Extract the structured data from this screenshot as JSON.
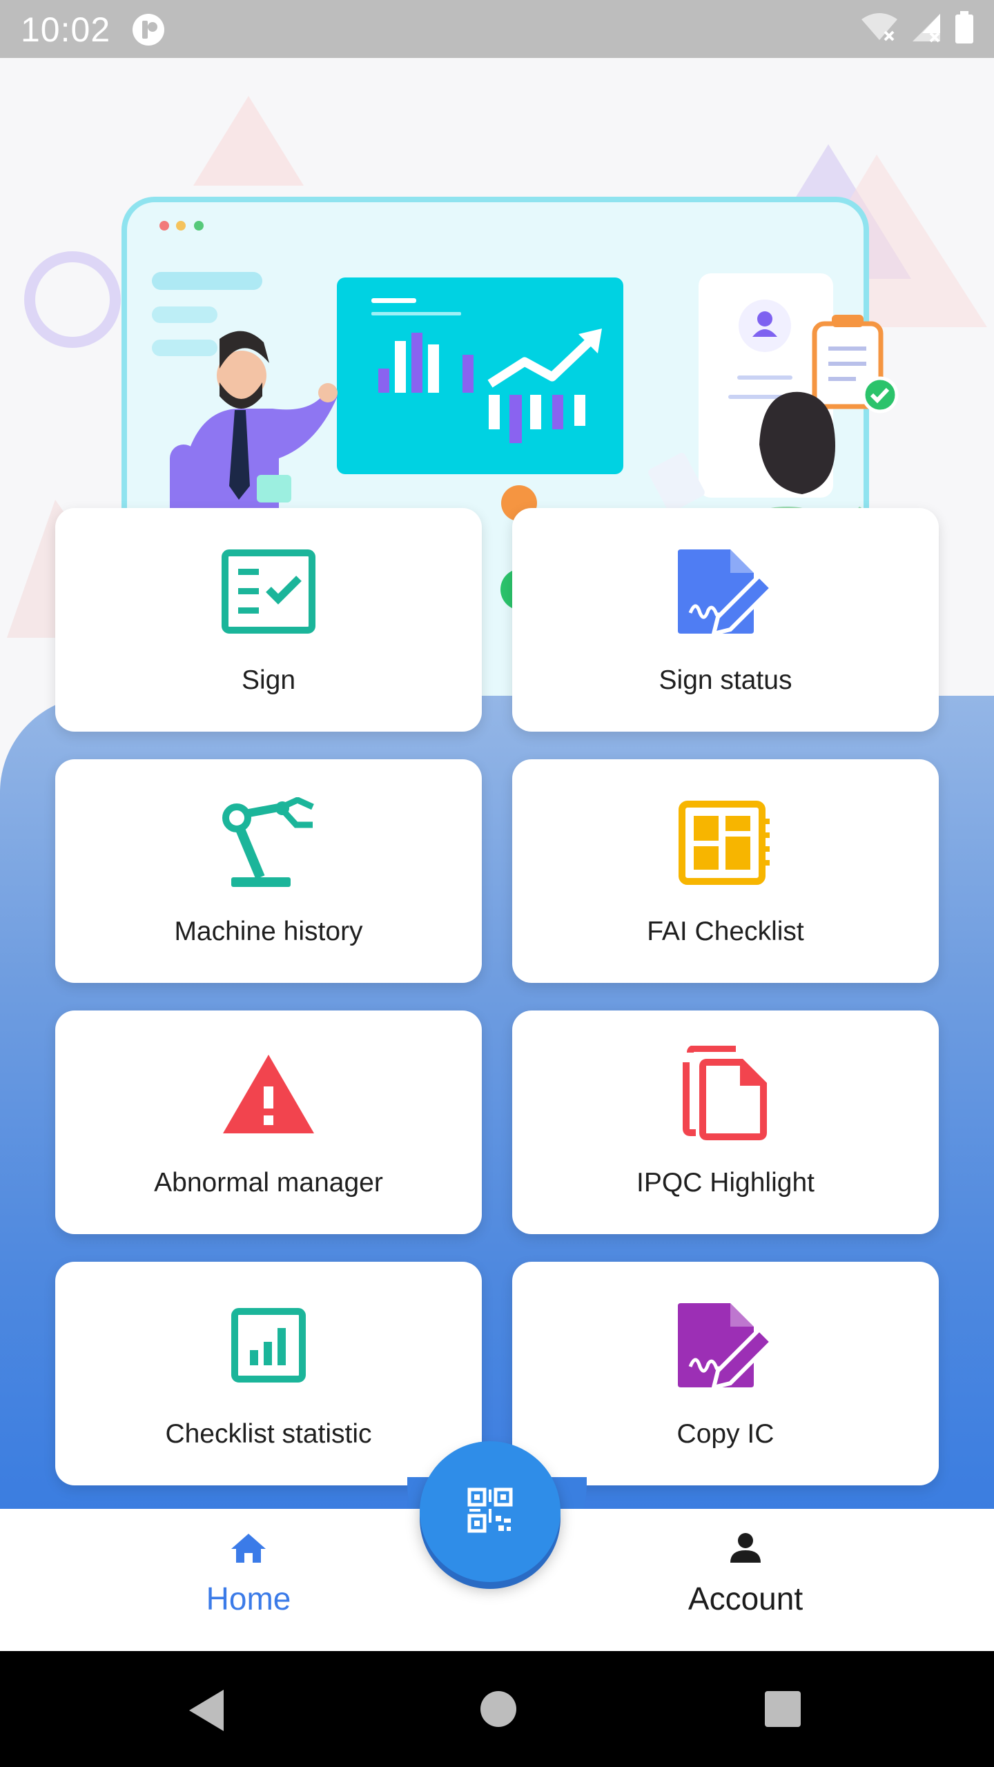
{
  "status_bar": {
    "time": "10:02"
  },
  "colors": {
    "teal": "#1bb59a",
    "blue": "#4f7df3",
    "amber": "#f7b500",
    "red": "#f2444e",
    "purple": "#9c2fb5",
    "nav_active": "#3b7be8",
    "fab": "#2f8de8"
  },
  "menu": {
    "items": [
      {
        "label": "Sign",
        "icon": "checklist-form-icon"
      },
      {
        "label": "Sign status",
        "icon": "document-signature-icon"
      },
      {
        "label": "Machine history",
        "icon": "robot-arm-icon"
      },
      {
        "label": "FAI Checklist",
        "icon": "dashboard-panel-icon"
      },
      {
        "label": "Abnormal manager",
        "icon": "warning-triangle-icon"
      },
      {
        "label": "IPQC Highlight",
        "icon": "copy-files-icon"
      },
      {
        "label": "Checklist statistic",
        "icon": "bar-chart-icon"
      },
      {
        "label": "Copy IC",
        "icon": "document-signature-icon"
      }
    ]
  },
  "bottom_nav": {
    "home": {
      "label": "Home",
      "icon": "home-icon"
    },
    "account": {
      "label": "Account",
      "icon": "person-icon"
    },
    "fab_icon": "qr-code-scan-icon"
  }
}
